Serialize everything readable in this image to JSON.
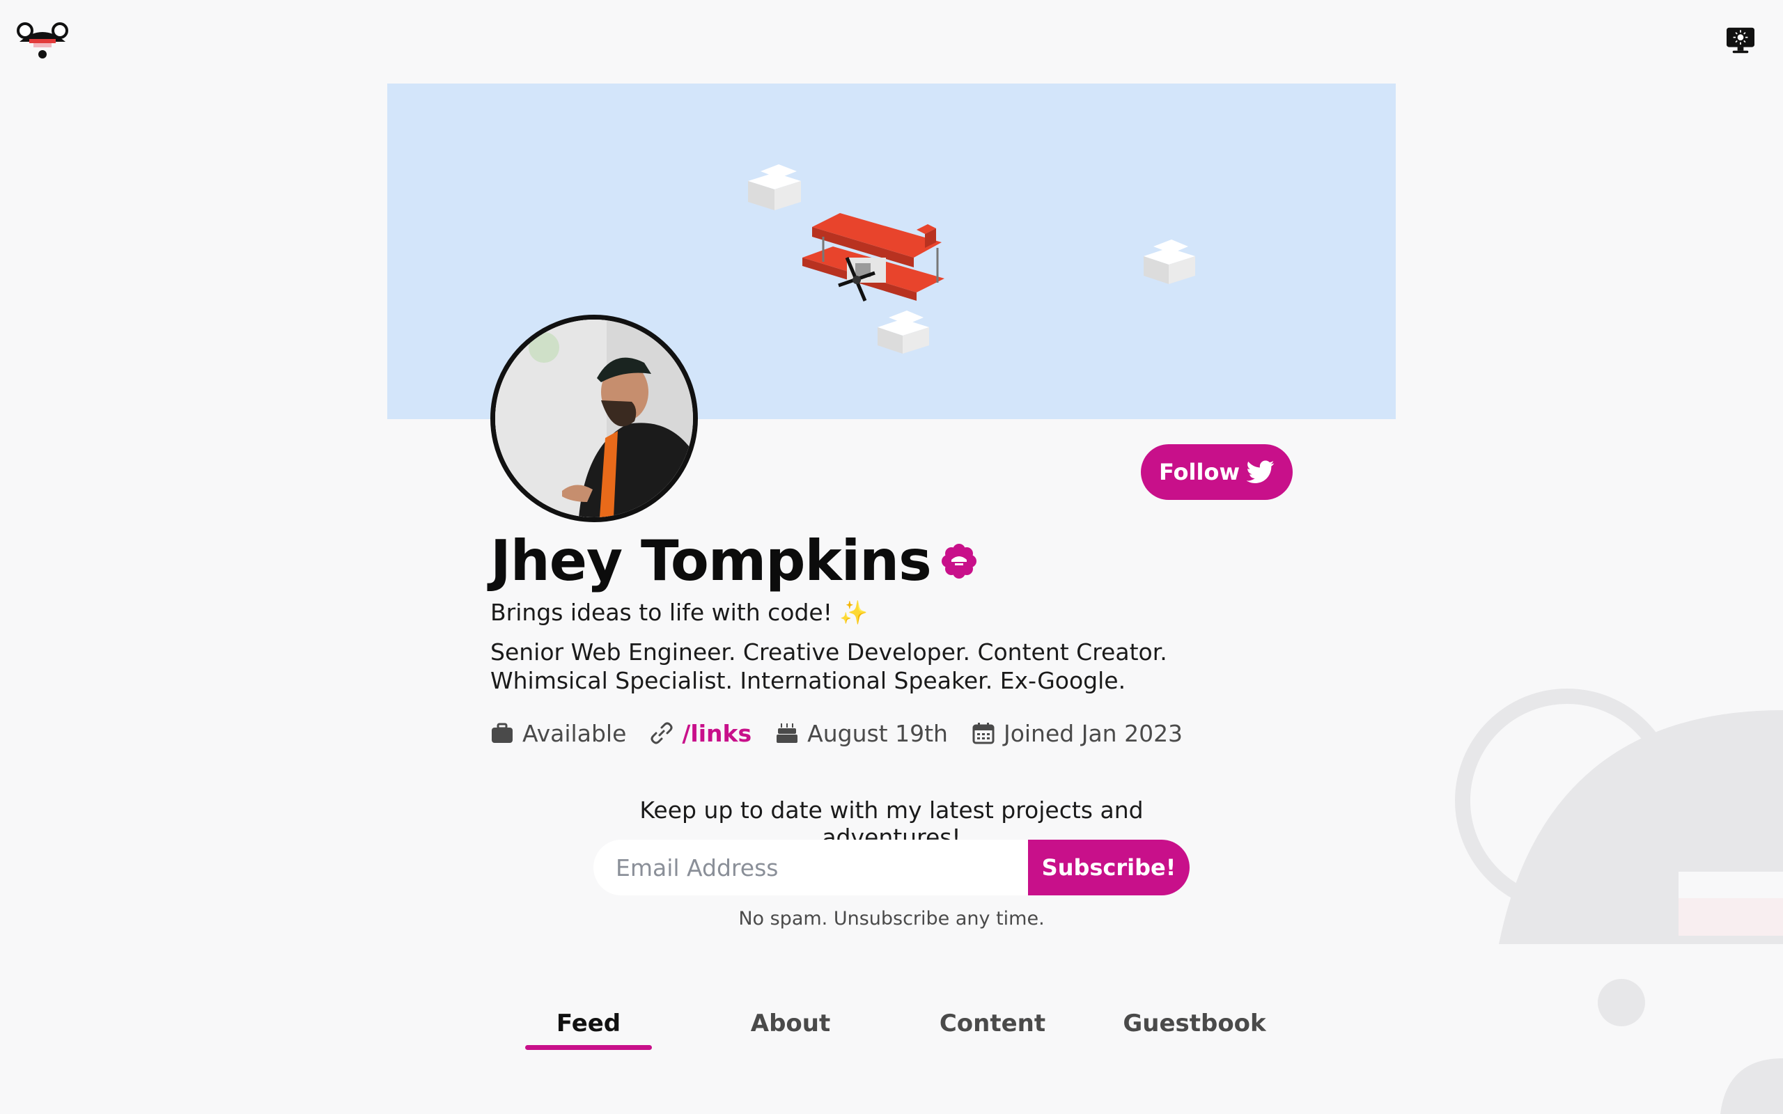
{
  "header": {
    "logo_icon": "bear-logo-icon",
    "theme_toggle_icon": "monitor-sun-icon"
  },
  "banner": {
    "illustration": "biplane-clouds-illustration",
    "background_color": "#d3e5fa"
  },
  "profile": {
    "name": "Jhey Tompkins",
    "verified_icon": "verified-badge-icon",
    "tagline": "Brings ideas to life with code! ✨",
    "bio": "Senior Web Engineer. Creative Developer. Content Creator. Whimsical Specialist. International Speaker. Ex-Google.",
    "follow_label": "Follow",
    "follow_icon": "twitter-bird-icon",
    "meta": {
      "status": "Available",
      "link": "/links",
      "birthday": "August 19th",
      "joined": "Joined Jan 2023"
    }
  },
  "newsletter": {
    "prompt": "Keep up to date with my latest projects and adventures!",
    "email_placeholder": "Email Address",
    "subscribe_label": "Subscribe!",
    "disclaimer": "No spam. Unsubscribe any time."
  },
  "tabs": [
    {
      "label": "Feed",
      "active": true
    },
    {
      "label": "About",
      "active": false
    },
    {
      "label": "Content",
      "active": false
    },
    {
      "label": "Guestbook",
      "active": false
    }
  ],
  "colors": {
    "accent": "#c8108a",
    "background": "#f8f8f9",
    "text": "#111111"
  }
}
